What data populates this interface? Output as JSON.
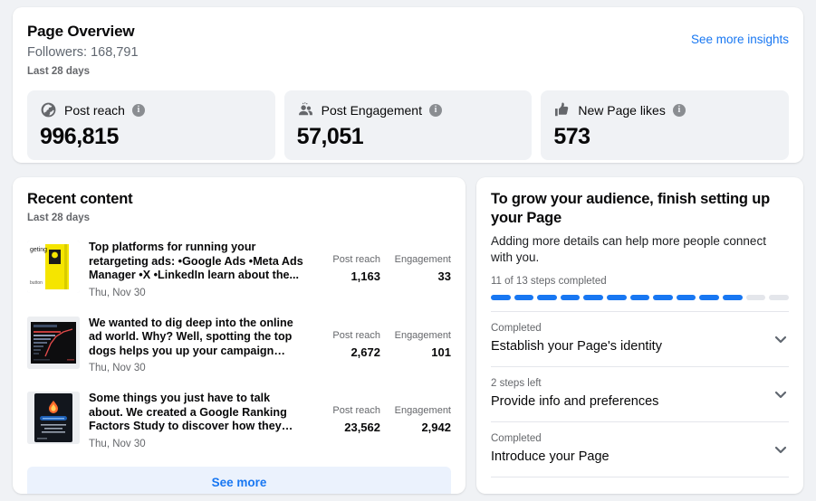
{
  "overview": {
    "title": "Page Overview",
    "followers": "Followers: 168,791",
    "range": "Last 28 days",
    "see_more_insights": "See more insights",
    "metrics": [
      {
        "icon": "globe-icon",
        "label": "Post reach",
        "value": "996,815",
        "info": "i"
      },
      {
        "icon": "people-icon",
        "label": "Post Engagement",
        "value": "57,051",
        "info": "i"
      },
      {
        "icon": "thumbs-up-icon",
        "label": "New Page likes",
        "value": "573",
        "info": "i"
      }
    ]
  },
  "recent": {
    "title": "Recent content",
    "range": "Last 28 days",
    "stat_labels": {
      "reach": "Post reach",
      "engagement": "Engagement"
    },
    "see_more": "See more",
    "posts": [
      {
        "text": "Top platforms for running your retargeting ads: •Google Ads •Meta Ads Manager •X •LinkedIn learn about the...",
        "date": "Thu, Nov 30",
        "reach": "1,163",
        "engagement": "33",
        "thumb": "yellow-illustration-thumbnail"
      },
      {
        "text": "We wanted to dig deep into the online ad world. Why? Well, spotting the top dogs helps you up your campaign game and...",
        "date": "Thu, Nov 30",
        "reach": "2,672",
        "engagement": "101",
        "thumb": "dark-bar-chart-thumbnail"
      },
      {
        "text": "Some things you just have to talk about. We created a Google Ranking Factors Study to discover how they correlate t...",
        "date": "Thu, Nov 30",
        "reach": "23,562",
        "engagement": "2,942",
        "thumb": "dark-flame-thumbnail"
      }
    ]
  },
  "grow": {
    "title": "To grow your audience, finish setting up your Page",
    "subtitle": "Adding more details can help more people connect with you.",
    "steps_label": "11 of 13 steps completed",
    "steps_total": 13,
    "steps_completed": 11,
    "items": [
      {
        "status": "Completed",
        "title": "Establish your Page's identity"
      },
      {
        "status": "2 steps left",
        "title": "Provide info and preferences"
      },
      {
        "status": "Completed",
        "title": "Introduce your Page"
      }
    ]
  },
  "colors": {
    "accent": "#1877f2",
    "page_bg": "#f0f2f5",
    "card_bg": "#ffffff",
    "muted_text": "#65676b",
    "progress_empty": "#e4e6eb"
  }
}
